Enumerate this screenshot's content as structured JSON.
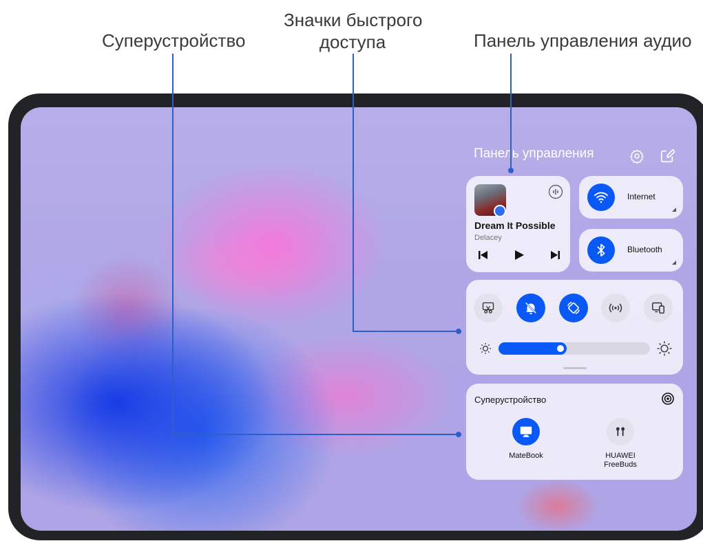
{
  "callouts": {
    "superdevice": "Суперустройство",
    "quick_access_line1": "Значки быстрого",
    "quick_access_line2": "доступа",
    "audio_panel": "Панель управления аудио"
  },
  "control_panel": {
    "title": "Панель управления",
    "settings_icon": "gear-icon",
    "edit_icon": "edit-icon"
  },
  "music": {
    "song_title": "Dream It Possible",
    "artist": "Delacey",
    "controls": [
      "previous-icon",
      "play-icon",
      "next-icon"
    ]
  },
  "toggles": [
    {
      "label": "Internet",
      "icon": "wifi-icon",
      "active": true
    },
    {
      "label": "Bluetooth",
      "icon": "bluetooth-icon",
      "active": true
    }
  ],
  "quick_icons": [
    {
      "icon": "screenshot-icon",
      "active": false
    },
    {
      "icon": "silent-bell-icon",
      "active": true
    },
    {
      "icon": "auto-rotate-icon",
      "active": true
    },
    {
      "icon": "hotspot-icon",
      "active": false
    },
    {
      "icon": "multi-screen-icon",
      "active": false
    }
  ],
  "brightness": {
    "level": 0.45
  },
  "superdevice": {
    "title": "Суперустройство",
    "devices": [
      {
        "label": "MateBook",
        "icon": "monitor-icon",
        "active": true
      },
      {
        "label_line1": "HUAWEI",
        "label_line2": "FreeBuds",
        "icon": "earbuds-icon",
        "active": false
      }
    ]
  },
  "colors": {
    "accent": "#0a59f7",
    "callout_line": "#2d5fc9"
  }
}
